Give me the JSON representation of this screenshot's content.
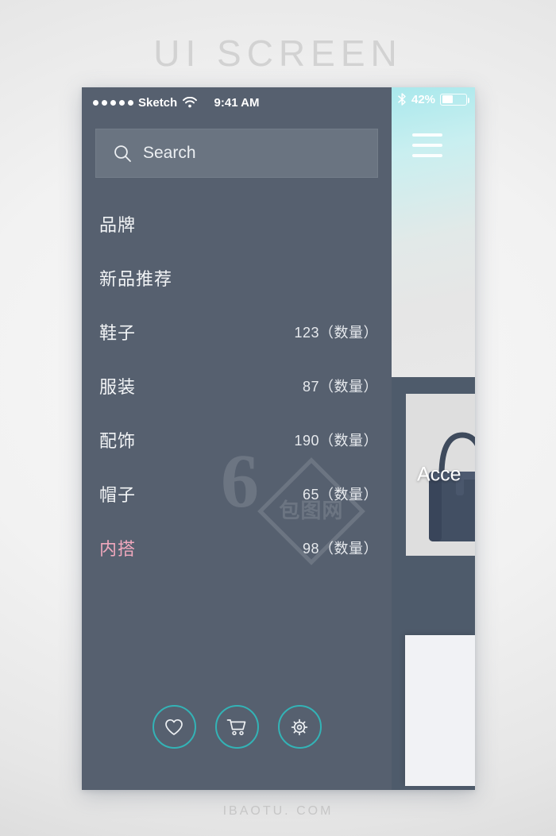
{
  "page": {
    "title": "UI SCREEN",
    "footer": "IBAOTU. COM"
  },
  "status_bar": {
    "carrier": "Sketch",
    "signal_dots": 5,
    "wifi_icon": "wifi-icon",
    "time": "9:41 AM"
  },
  "right_screen": {
    "status_bar": {
      "bluetooth_icon": "bluetooth-icon",
      "battery_percent": "42%",
      "battery_icon": "battery-icon",
      "battery_level": 42
    },
    "menu_icon": "hamburger-menu-icon",
    "cards": [
      {
        "label": "Acce",
        "image": "handbag-image"
      },
      {
        "label": "",
        "image": ""
      }
    ]
  },
  "search": {
    "icon": "search-icon",
    "placeholder": "Search",
    "value": ""
  },
  "menu": {
    "items": [
      {
        "label": "品牌",
        "count": "",
        "accent": false
      },
      {
        "label": "新品推荐",
        "count": "",
        "accent": false
      },
      {
        "label": "鞋子",
        "count": "123（数量）",
        "accent": false
      },
      {
        "label": "服装",
        "count": "87（数量）",
        "accent": false
      },
      {
        "label": "配饰",
        "count": "190（数量）",
        "accent": false
      },
      {
        "label": "帽子",
        "count": "65（数量）",
        "accent": false
      },
      {
        "label": "内搭",
        "count": "98（数量）",
        "accent": true
      }
    ]
  },
  "actions": [
    {
      "icon": "heart-icon",
      "name": "favorites-button"
    },
    {
      "icon": "cart-icon",
      "name": "cart-button"
    },
    {
      "icon": "gear-icon",
      "name": "settings-button"
    }
  ],
  "watermark": {
    "number": "6",
    "text": "包图网"
  },
  "colors": {
    "sidebar_bg": "#56606f",
    "search_bg": "#6a7481",
    "accent_teal": "#33b3b6",
    "accent_pink": "#f0a8bd",
    "right_panel_bg": "#4e5b6b",
    "hero_gradient_start": "#a9e8ec"
  }
}
